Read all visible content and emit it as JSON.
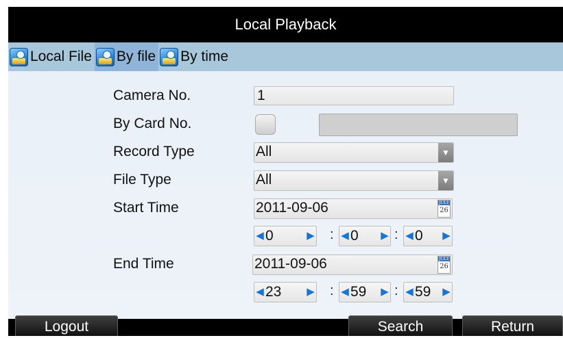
{
  "window": {
    "title": "Local Playback"
  },
  "tabs": [
    {
      "label": "Local File",
      "active": false
    },
    {
      "label": "By file",
      "active": true
    },
    {
      "label": "By time",
      "active": false
    }
  ],
  "form": {
    "camera_no": {
      "label": "Camera No.",
      "value": "1"
    },
    "by_card_no": {
      "label": "By Card No.",
      "checked": false,
      "value": ""
    },
    "record_type": {
      "label": "Record Type",
      "value": "All"
    },
    "file_type": {
      "label": "File Type",
      "value": "All"
    },
    "start_time": {
      "label": "Start Time",
      "date": "2011-09-06",
      "hour": "0",
      "minute": "0",
      "second": "0"
    },
    "end_time": {
      "label": "End Time",
      "date": "2011-09-06",
      "hour": "23",
      "minute": "59",
      "second": "59"
    },
    "calendar_icon": {
      "month": "JULY",
      "day": "26"
    },
    "time_separator": ":"
  },
  "buttons": {
    "logout": "Logout",
    "search": "Search",
    "return": "Return"
  },
  "colors": {
    "title_bar": "#000000",
    "tab_bar": "#a9c7da",
    "active_tab": "#8fb4d8",
    "content_bg": "#e9f0f8",
    "spinner_arrow": "#1a74d2"
  },
  "icons": {
    "tab": "playback-folder-icon",
    "calendar": "calendar-icon",
    "dropdown": "chevron-down-icon"
  }
}
